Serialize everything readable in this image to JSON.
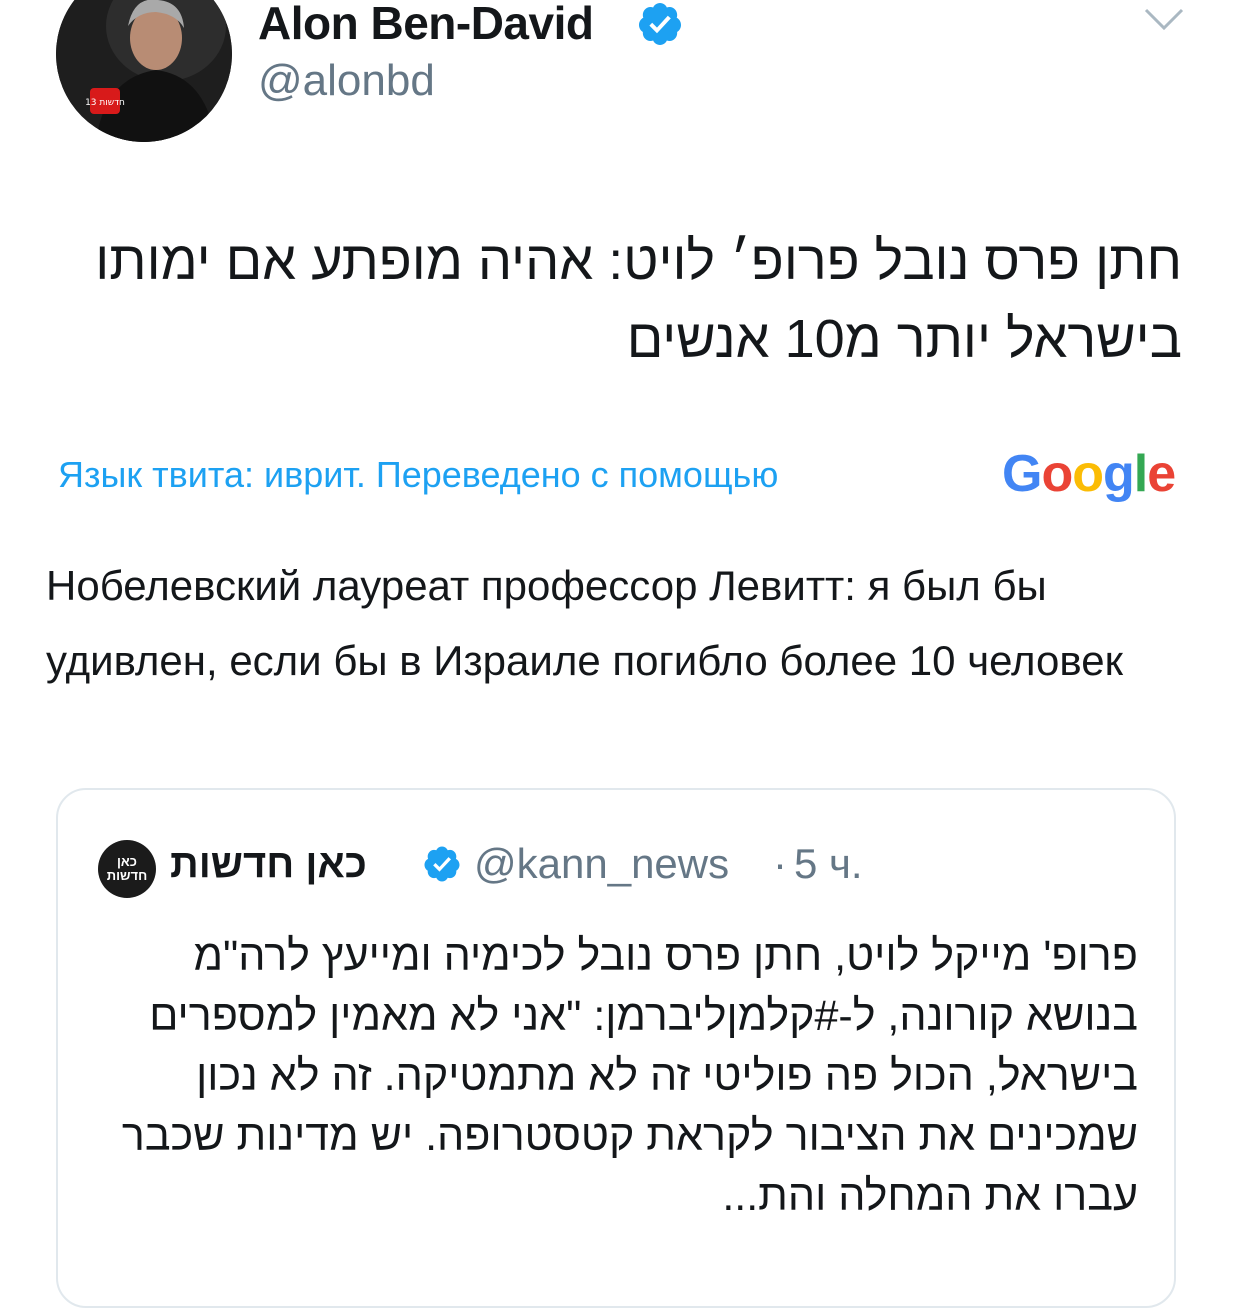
{
  "author": {
    "display_name": "Alon Ben-David",
    "handle": "@alonbd",
    "verified": true,
    "avatar_badge": "13 חדשות"
  },
  "tweet": {
    "text": "חתן פרס נובל פרופ׳ לויט: אהיה מופתע אם ימותו בישראל יותר מ10 אנשים"
  },
  "translation": {
    "notice": "Язык твита: иврит. Переведено с помощью",
    "provider": {
      "letters": [
        "G",
        "o",
        "o",
        "g",
        "l",
        "e"
      ]
    },
    "text": "Нобелевский лауреат профессор Левитт: я был бы удивлен, если бы в Израиле погибло более 10 человек"
  },
  "quoted_tweet": {
    "avatar_text_line1": "כאן",
    "avatar_text_line2": "חדשות",
    "display_name": "כאן חדשות",
    "verified": true,
    "handle": "@kann_news",
    "separator": "·",
    "time": "5 ч.",
    "text": "פרופ' מייקל לויט, חתן פרס נובל לכימיה ומייעץ לרה\"מ בנושא קורונה, ל-#קלמןליברמן: \"אני לא מאמין למספרים בישראל, הכול פה פוליטי זה לא מתמטיקה. זה לא נכון שמכינים את הציבור לקראת קטסטרופה. יש מדינות שכבר עברו את המחלה והת..."
  },
  "colors": {
    "link_blue": "#1da1f2",
    "secondary_text": "#657786",
    "primary_text": "#14171a",
    "border": "#e1e8ed",
    "verified_badge": "#1da1f2"
  },
  "icons": {
    "verified": "verified-badge-icon",
    "menu": "chevron-down-icon"
  }
}
